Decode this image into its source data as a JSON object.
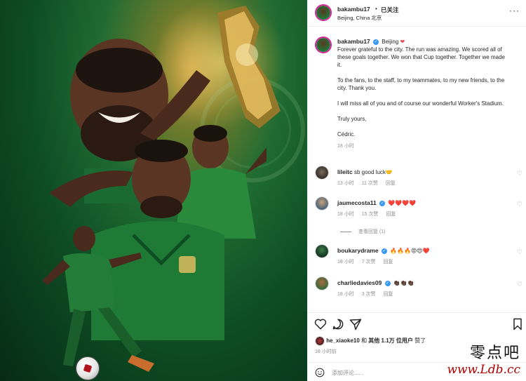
{
  "post": {
    "username": "bakambu17",
    "follow_label": "已关注",
    "location": "Beijing, China 北京",
    "more": "···"
  },
  "caption": {
    "username": "bakambu17",
    "location_tag": "Beijing",
    "lines": [
      "Forever grateful to the city. The run was amazing. We scored all of",
      "these goals together. We won that Cup together. Together we made",
      "it.",
      "",
      "To the fans, to the staff, to my teammates, to my new friends, to the",
      "city. Thank you.",
      "",
      "I will miss all of you and of course our wonderful Worker's Stadium.",
      "",
      "Truly yours,",
      "",
      "Cédric."
    ],
    "time": "18 小时"
  },
  "comments": [
    {
      "user": "lileitc",
      "text": "sb good luck🤝",
      "time": "13 小时",
      "likes": "11 次赞",
      "reply": "回复",
      "verified": false
    },
    {
      "user": "jaumecosta11",
      "text": "❤️❤️❤️❤️",
      "time": "18 小时",
      "likes": "15 次赞",
      "reply": "回复",
      "verified": true,
      "view_replies": "查看回复 (1)"
    },
    {
      "user": "boukarydrame",
      "text": "🔥🔥🔥😡😍❤️",
      "time": "18 小时",
      "likes": "7 次赞",
      "reply": "回复",
      "verified": true
    },
    {
      "user": "charliedavies09",
      "text": "👏🏿👏🏿👏🏿",
      "time": "18 小时",
      "likes": "3 次赞",
      "reply": "回复",
      "verified": true
    }
  ],
  "likes_line": {
    "user": "he_xiaoke10",
    "mid": "和",
    "others": "其他 1.1万 位用户",
    "end": "赞了"
  },
  "post_time": "18 小时前",
  "add_comment_placeholder": "添加评论......",
  "watermark": {
    "line1": "零点吧",
    "line2": "www.Ldb.cc"
  },
  "colors": {
    "accent_blue": "#3897f0",
    "heart_red": "#ed4956",
    "meta_gray": "#8e8e8e",
    "pitch_green": "#1f6b32"
  },
  "icons": [
    "heart-icon",
    "comment-icon",
    "share-icon",
    "bookmark-icon",
    "emoji-icon",
    "more-icon",
    "verified-icon"
  ]
}
